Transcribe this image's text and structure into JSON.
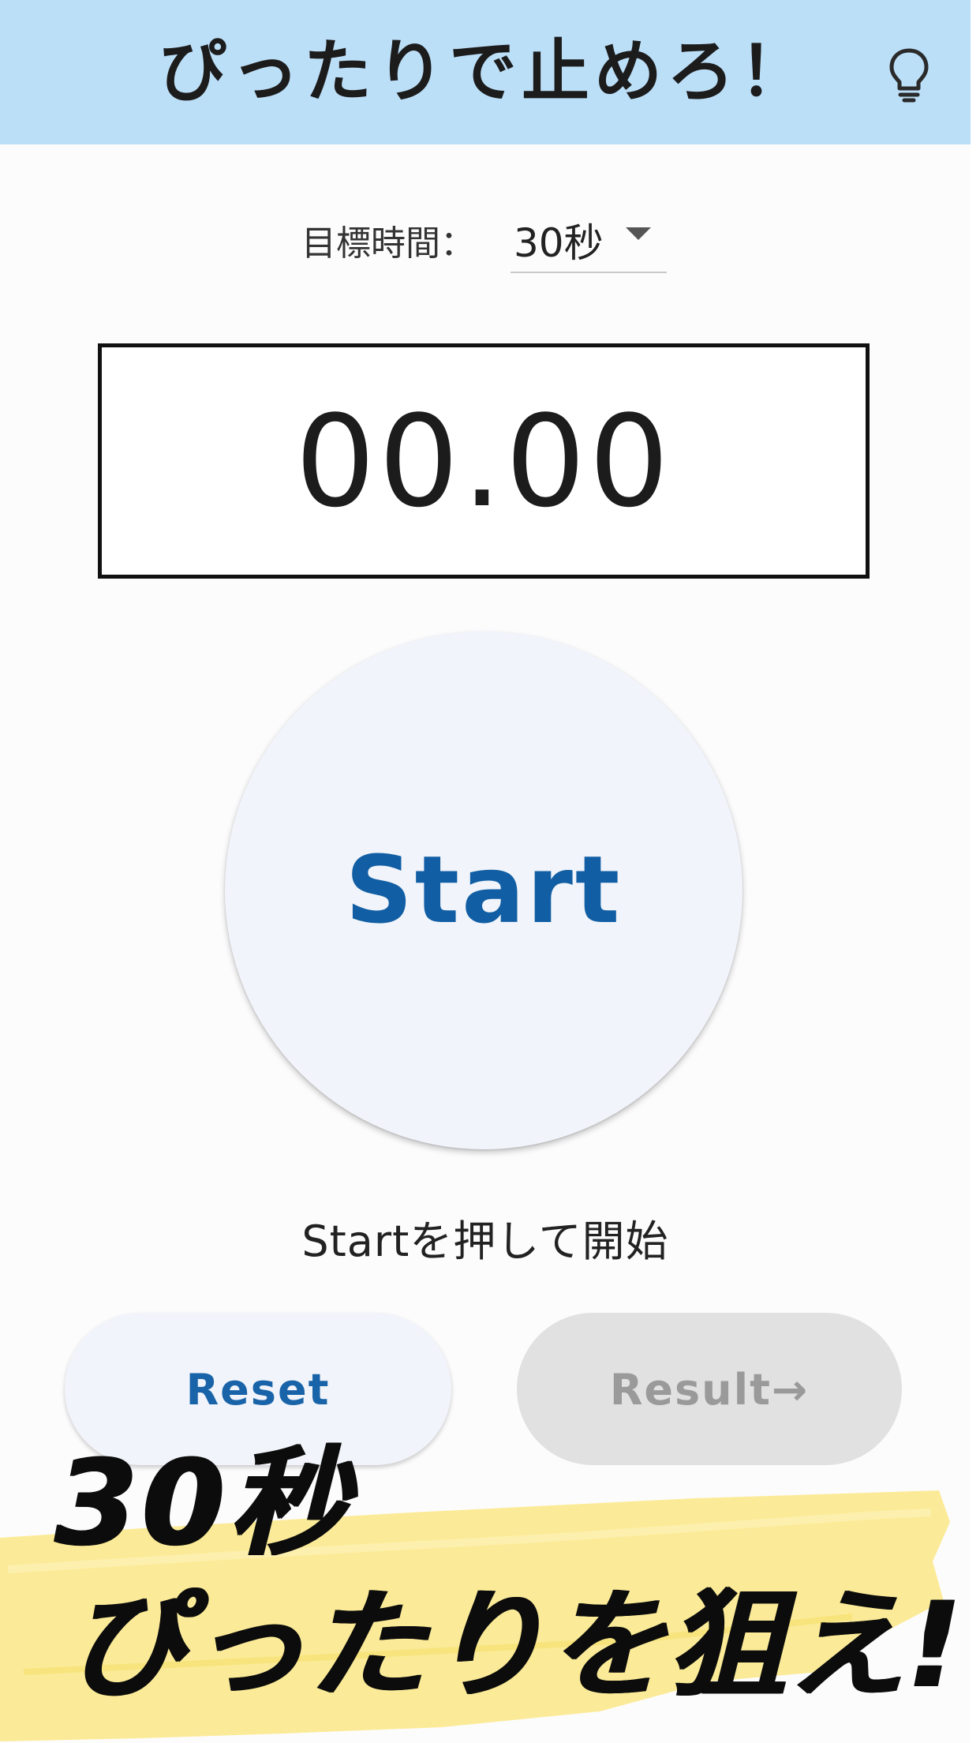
{
  "app_bar": {
    "title": "ぴったりで止めろ！",
    "background": "#bcdff8",
    "action_icon": "lightbulb-icon"
  },
  "target": {
    "label": "目標時間：",
    "selected": "30秒"
  },
  "timer": {
    "display": "00.00"
  },
  "start_button": {
    "label": "Start",
    "color": "#115ea4"
  },
  "hint": "Startを押して開始",
  "reset_button": {
    "label": "Reset"
  },
  "result_button": {
    "label": "Result→",
    "disabled": true
  },
  "promo_banner": {
    "line1": "30秒",
    "line2": "ぴったりを狙え!",
    "highlight_color": "#fbe98f"
  }
}
